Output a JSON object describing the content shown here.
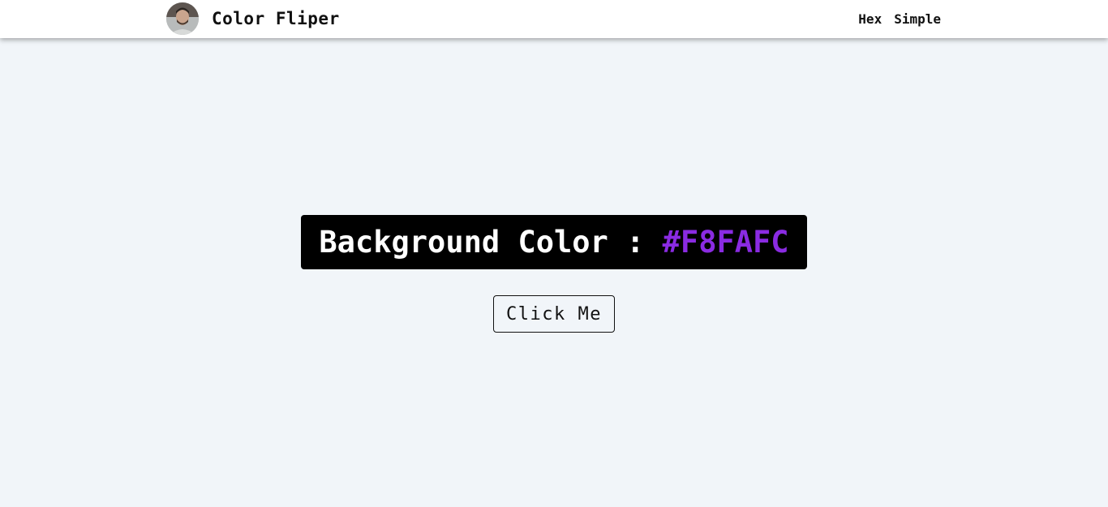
{
  "navbar": {
    "brand_title": "Color Fliper",
    "links": [
      {
        "label": "Hex"
      },
      {
        "label": "Simple"
      }
    ]
  },
  "main": {
    "color_label": "Background Color : ",
    "color_value": "#F8FAFC",
    "button_label": "Click Me"
  },
  "colors": {
    "page_background": "#f1f5f9",
    "navbar_background": "#ffffff",
    "box_background": "#000000",
    "label_text": "#ffffff",
    "value_text": "#8a2be2"
  },
  "icons": {
    "avatar": "user-avatar-photo"
  }
}
